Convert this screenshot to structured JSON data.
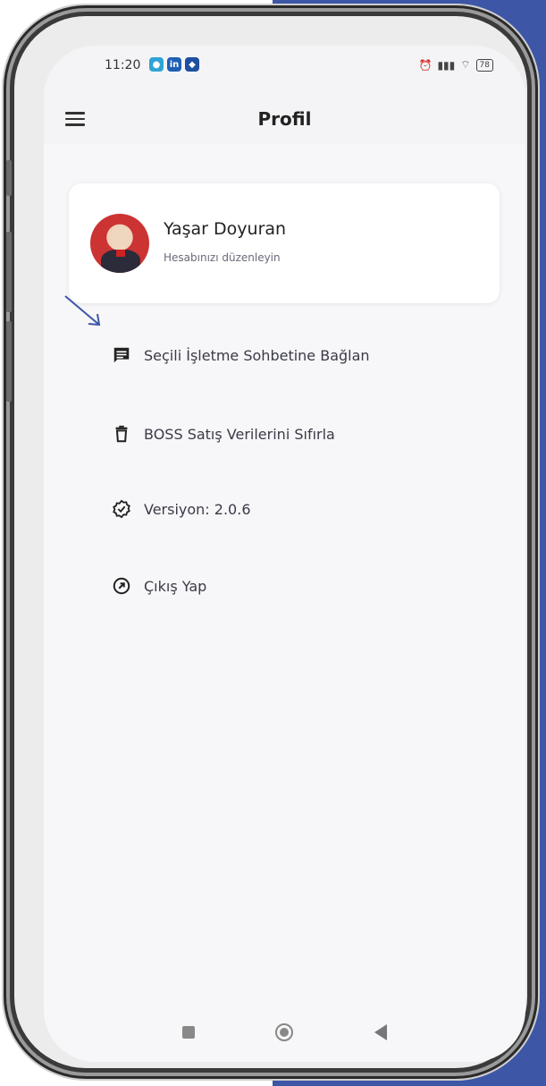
{
  "status_bar": {
    "time": "11:20",
    "battery": "78",
    "chip_icons": [
      {
        "name": "app-notification-icon",
        "color": "#2ea3d6"
      },
      {
        "name": "linkedin-icon",
        "color": "#1d5fb5"
      },
      {
        "name": "app-shield-icon",
        "color": "#1f4fa0"
      }
    ]
  },
  "appbar": {
    "title": "Profil",
    "menu_icon": "hamburger-menu-icon"
  },
  "profile": {
    "name": "Yaşar Doyuran",
    "subtitle": "Hesabınızı düzenleyin",
    "avatar_icon": "avatar"
  },
  "menu": {
    "items": [
      {
        "label": "Seçili İşletme Sohbetine Bağlan",
        "icon": "chat-icon"
      },
      {
        "label": "BOSS Satış Verilerini Sıfırla",
        "icon": "trash-icon"
      },
      {
        "label": "Versiyon: 2.0.6",
        "icon": "verified-badge-icon"
      },
      {
        "label": "Çıkış Yap",
        "icon": "logout-icon"
      }
    ]
  },
  "colors": {
    "accent_background": "#3d56a6",
    "screen_background": "#f7f7f9",
    "annotation_arrow": "#3d56a6",
    "text_primary": "#222222",
    "text_secondary": "#6a6a7a"
  }
}
